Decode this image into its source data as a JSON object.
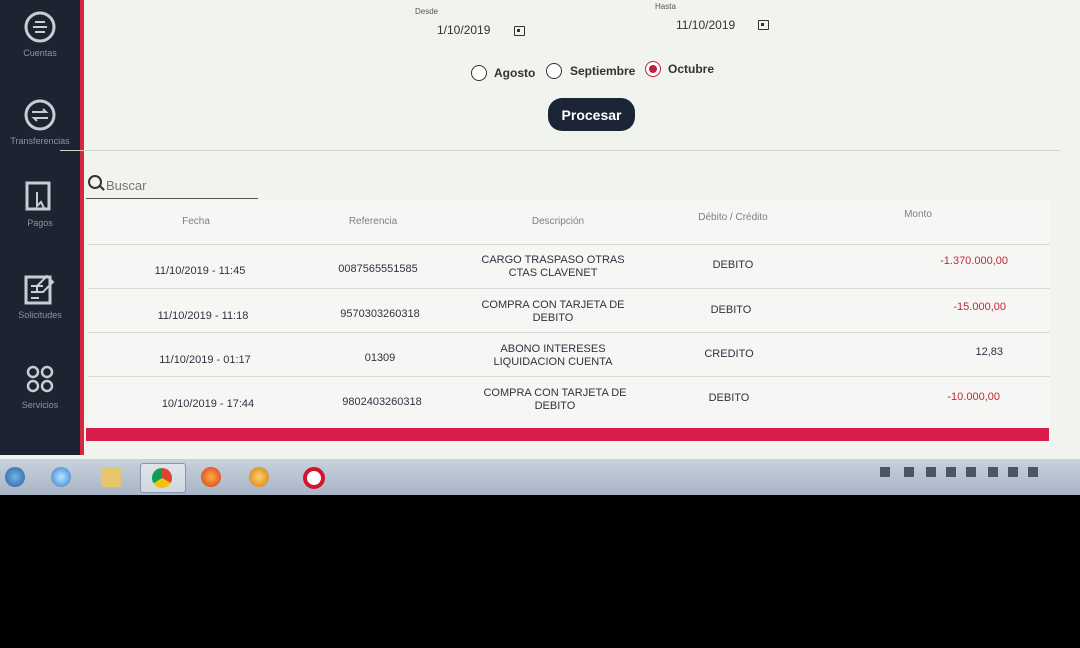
{
  "sidebar": {
    "items": [
      {
        "label": "Cuentas",
        "icon": "coin-icon"
      },
      {
        "label": "Transferencias",
        "icon": "transfer-icon"
      },
      {
        "label": "Pagos",
        "icon": "payments-icon"
      },
      {
        "label": "Solicitudes",
        "icon": "form-icon"
      },
      {
        "label": "Servicios",
        "icon": "grid-dots-icon"
      }
    ]
  },
  "filter": {
    "desde_label": "Desde",
    "desde_value": "1/10/2019",
    "hasta_label": "Hasta",
    "hasta_value": "11/10/2019",
    "months": [
      {
        "label": "Agosto",
        "checked": false
      },
      {
        "label": "Septiembre",
        "checked": false
      },
      {
        "label": "Octubre",
        "checked": true
      }
    ],
    "process_label": "Procesar"
  },
  "search": {
    "placeholder": "Buscar"
  },
  "table": {
    "headers": [
      "Fecha",
      "Referencia",
      "Descripción",
      "Débito / Crédito",
      "Monto"
    ],
    "rows": [
      {
        "fecha": "11/10/2019 - 11:45",
        "referencia": "0087565551585",
        "desc1": "CARGO TRASPASO OTRAS",
        "desc2": "CTAS CLAVENET",
        "tipo": "DEBITO",
        "monto": "-1.370.000,00"
      },
      {
        "fecha": "11/10/2019 - 11:18",
        "referencia": "9570303260318",
        "desc1": "COMPRA CON TARJETA DE",
        "desc2": "DEBITO",
        "tipo": "DEBITO",
        "monto": "-15.000,00"
      },
      {
        "fecha": "11/10/2019 - 01:17",
        "referencia": "01309",
        "desc1": "ABONO INTERESES",
        "desc2": "LIQUIDACION CUENTA",
        "tipo": "CREDITO",
        "monto": "12,83"
      },
      {
        "fecha": "10/10/2019 - 17:44",
        "referencia": "9802403260318",
        "desc1": "COMPRA CON TARJETA DE",
        "desc2": "DEBITO",
        "tipo": "DEBITO",
        "monto": "-10.000,00"
      }
    ]
  },
  "colors": {
    "accent": "#d81d4a",
    "sidebar": "#1c2431",
    "button": "#1b2535",
    "negative": "#c0283a"
  }
}
